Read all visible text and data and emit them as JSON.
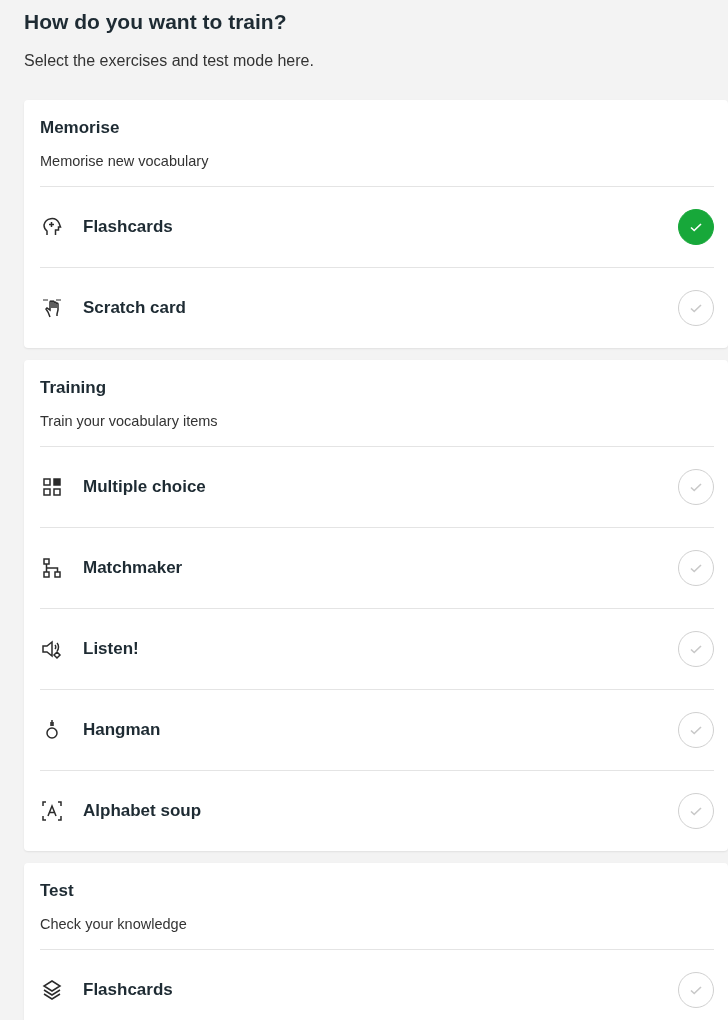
{
  "title": "How do you want to train?",
  "subtitle": "Select the exercises and test mode here.",
  "sections": [
    {
      "title": "Memorise",
      "description": "Memorise new vocabulary",
      "exercises": [
        {
          "kind": "head",
          "label": "Flashcards",
          "selected": true
        },
        {
          "kind": "hand",
          "label": "Scratch card",
          "selected": false
        }
      ]
    },
    {
      "title": "Training",
      "description": "Train your vocabulary items",
      "exercises": [
        {
          "kind": "grid",
          "label": "Multiple choice",
          "selected": false
        },
        {
          "kind": "tree",
          "label": "Matchmaker",
          "selected": false
        },
        {
          "kind": "speaker",
          "label": "Listen!",
          "selected": false
        },
        {
          "kind": "noose",
          "label": "Hangman",
          "selected": false
        },
        {
          "kind": "letter",
          "label": "Alphabet soup",
          "selected": false
        }
      ]
    },
    {
      "title": "Test",
      "description": "Check your knowledge",
      "exercises": [
        {
          "kind": "layers",
          "label": "Flashcards",
          "selected": false
        }
      ]
    }
  ]
}
